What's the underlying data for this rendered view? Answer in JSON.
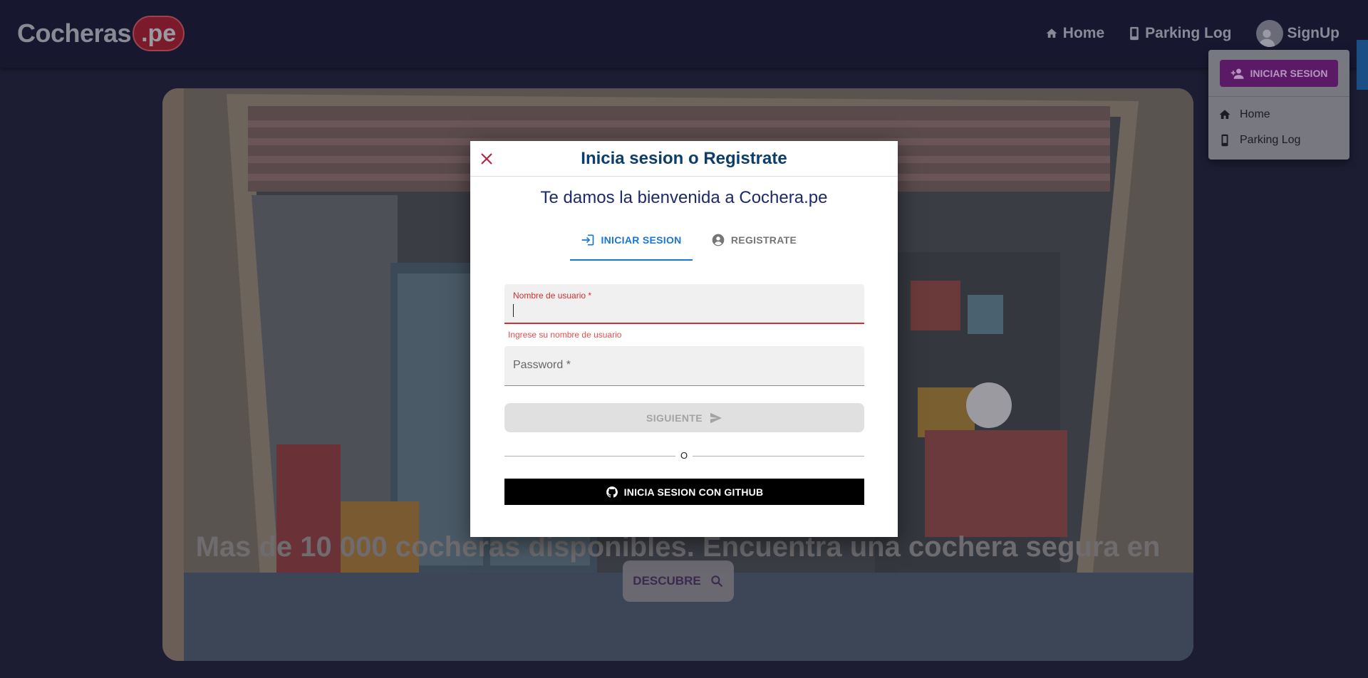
{
  "header": {
    "logo_text": "Cocheras",
    "logo_badge": ".pe",
    "nav": [
      {
        "label": "Home",
        "icon": "home-icon"
      },
      {
        "label": "Parking Log",
        "icon": "phone-icon"
      },
      {
        "label": "SignUp",
        "icon": "avatar-icon"
      }
    ]
  },
  "hero": {
    "headline": "Mas de 10 000 cocheras disponibles. Encuentra una cochera segura en",
    "discover_label": "DESCUBRE",
    "discover_icon": "search-icon"
  },
  "menu": {
    "login_label": "INICIAR SESION",
    "login_icon": "person-add-icon",
    "items": [
      {
        "label": "Home",
        "icon": "home-icon"
      },
      {
        "label": "Parking Log",
        "icon": "phone-icon"
      }
    ]
  },
  "dialog": {
    "title": "Inicia sesion o Registrate",
    "welcome": "Te damos la bienvenida a Cochera.pe",
    "tabs": [
      {
        "label": "INICIAR SESION",
        "icon": "login-icon",
        "active": true
      },
      {
        "label": "REGISTRATE",
        "icon": "account-circle-icon",
        "active": false
      }
    ],
    "username_label": "Nombre de usuario *",
    "username_value": "",
    "username_error": "Ingrese su nombre de usuario",
    "password_label": "Password *",
    "next_label": "SIGUIENTE",
    "divider_text": "O",
    "github_label": "INICIA SESION CON GITHUB"
  },
  "colors": {
    "accent_blue": "#1976d2",
    "error_red": "#d32f2f",
    "title_navy": "#0d3d6b",
    "purple": "#7b1fa2"
  }
}
